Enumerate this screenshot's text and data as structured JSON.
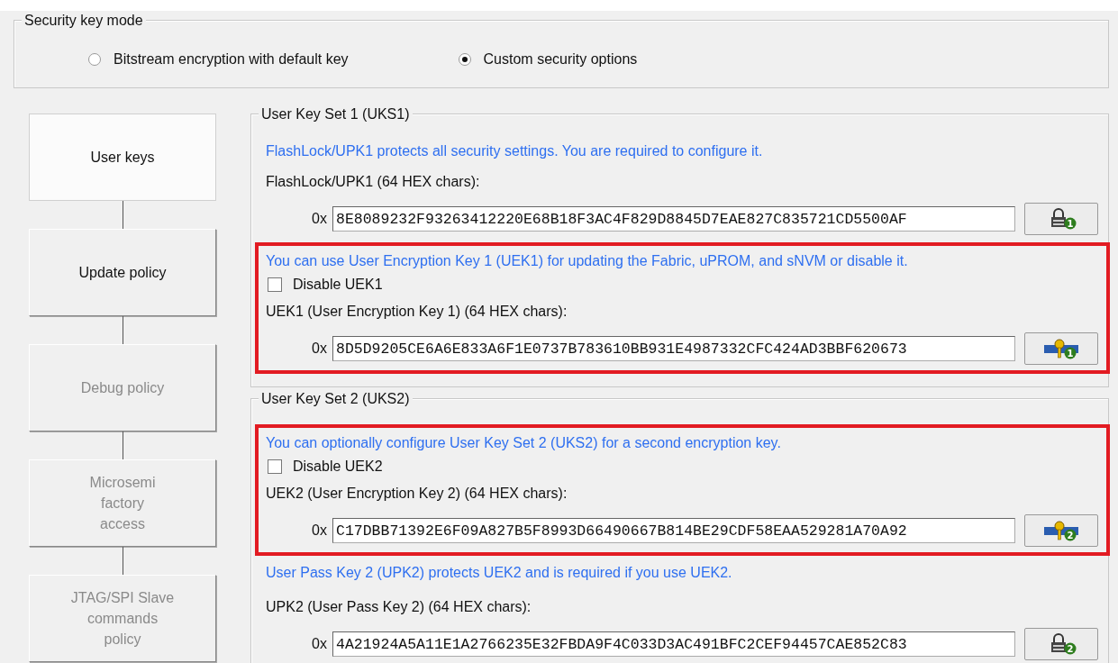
{
  "security_key_mode": {
    "legend": "Security key mode",
    "options": [
      {
        "label": "Bitstream encryption with default key",
        "selected": false
      },
      {
        "label": "Custom security options",
        "selected": true
      }
    ]
  },
  "steps": [
    {
      "label": "User keys",
      "selected": true,
      "disabled": false
    },
    {
      "label": "Update policy",
      "selected": false,
      "disabled": false
    },
    {
      "label": "Debug policy",
      "selected": false,
      "disabled": true
    },
    {
      "label": "Microsemi\nfactory\naccess",
      "selected": false,
      "disabled": true
    },
    {
      "label": "JTAG/SPI Slave\ncommands\npolicy",
      "selected": false,
      "disabled": true
    }
  ],
  "key_sets": [
    {
      "legend": "User Key Set 1 (UKS1)",
      "items": [
        {
          "kind": "note",
          "text": "FlashLock/UPK1 protects all security settings. You are required to configure it."
        },
        {
          "kind": "label",
          "text": "FlashLock/UPK1 (64 HEX chars):"
        },
        {
          "kind": "pass_key",
          "prefix": "0x",
          "value": "8E8089232F93263412220E68B18F3AC4F829D8845D7EAE827C835721CD5500AF",
          "badge": "1"
        },
        {
          "kind": "highlight",
          "items": [
            {
              "kind": "note",
              "text": "You can use User Encryption Key 1 (UEK1) for updating the Fabric, uPROM, and sNVM or disable it."
            },
            {
              "kind": "checkbox",
              "label": "Disable UEK1",
              "checked": false
            },
            {
              "kind": "label",
              "text": "UEK1 (User Encryption Key 1) (64 HEX chars):"
            },
            {
              "kind": "encryption_key",
              "prefix": "0x",
              "value": "8D5D9205CE6A6E833A6F1E0737B783610BB931E4987332CFC424AD3BBF620673",
              "badge": "1"
            }
          ]
        }
      ]
    },
    {
      "legend": "User Key Set 2 (UKS2)",
      "items": [
        {
          "kind": "highlight",
          "items": [
            {
              "kind": "note",
              "text": "You can optionally configure User Key Set 2 (UKS2) for a second encryption key."
            },
            {
              "kind": "checkbox",
              "label": "Disable UEK2",
              "checked": false
            },
            {
              "kind": "label",
              "text": "UEK2 (User Encryption Key 2) (64 HEX chars):"
            },
            {
              "kind": "encryption_key",
              "prefix": "0x",
              "value": "C17DBB71392E6F09A827B5F8993D66490667B814BE29CDF58EAA529281A70A92",
              "badge": "2"
            }
          ]
        },
        {
          "kind": "note",
          "text": "User Pass Key 2 (UPK2) protects UEK2 and is required if you use UEK2."
        },
        {
          "kind": "label",
          "text": "UPK2 (User Pass Key 2) (64 HEX chars):"
        },
        {
          "kind": "pass_key",
          "prefix": "0x",
          "value": "4A21924A5A11E1A2766235E32FBDA9F4C033D3AC491BFC2CEF94457CAE852C83",
          "badge": "2"
        }
      ]
    }
  ]
}
